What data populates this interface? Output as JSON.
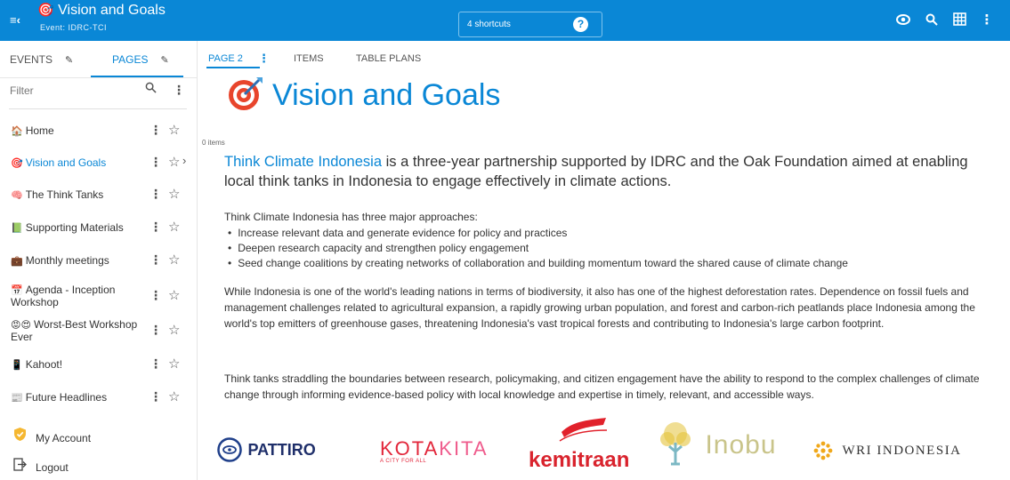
{
  "topbar": {
    "menu_icon": "menu-collapse-icon",
    "title_emoji": "🎯",
    "title": "Vision and Goals",
    "event": "Event: IDRC-TCI",
    "shortcuts_label": "4 shortcuts",
    "help_glyph": "?",
    "icons": [
      "eye-icon",
      "search-icon",
      "grid-icon",
      "more-vertical-icon"
    ],
    "accent": "#0a87d6"
  },
  "left": {
    "tabs": [
      {
        "label": "EVENTS",
        "active": false
      },
      {
        "label": "PAGES",
        "active": true
      }
    ],
    "filter_placeholder": "Filter",
    "pages": [
      {
        "icon": "🏠",
        "label": "Home"
      },
      {
        "icon": "🎯",
        "label": "Vision and Goals",
        "active": true
      },
      {
        "icon": "🧠",
        "label": "The Think Tanks"
      },
      {
        "icon": "📗",
        "label": "Supporting Materials"
      },
      {
        "icon": "💼",
        "label": "Monthly meetings"
      },
      {
        "icon": "📅",
        "label": "Agenda - Inception Workshop"
      },
      {
        "icon": "😡😍",
        "label": "Worst-Best Workshop Ever"
      },
      {
        "icon": "📱",
        "label": "Kahoot!"
      },
      {
        "icon": "📰",
        "label": "Future Headlines"
      }
    ],
    "account": {
      "icon": "shield-icon",
      "label": "My Account"
    },
    "logout": {
      "icon": "logout-icon",
      "label": "Logout"
    }
  },
  "main": {
    "subtabs": [
      {
        "label": "PAGE 2",
        "active": true
      },
      {
        "label": "ITEMS",
        "active": false
      },
      {
        "label": "TABLE PLANS",
        "active": false
      }
    ],
    "heading": "Vision and Goals",
    "items_count": "0 items",
    "intro_lead": "Think Climate Indonesia",
    "intro_rest": " is a three-year partnership supported by IDRC and the Oak Foundation aimed at enabling local think tanks in Indonesia to engage effectively in climate actions.",
    "approaches_title": "Think Climate Indonesia has three major approaches:",
    "approaches": [
      "Increase relevant data and generate evidence for policy and practices",
      "Deepen research capacity and strengthen policy engagement",
      "Seed change coalitions by creating networks of collaboration and building momentum toward the shared cause of climate change"
    ],
    "para1": "While Indonesia is one of the world's leading nations in terms of biodiversity, it also has one of the highest deforestation rates. Dependence on fossil fuels and management challenges related to agricultural expansion, a rapidly growing urban population, and forest and carbon-rich peatlands place Indonesia among the world's top emitters of greenhouse gases, threatening Indonesia's vast tropical forests and contributing to Indonesia's large carbon footprint.",
    "para2": "Think tanks straddling the boundaries between research, policymaking, and citizen engagement have the ability to respond to the complex challenges of climate change through informing evidence-based policy with local knowledge and expertise in timely, relevant, and accessible ways.",
    "logos": {
      "pattiro": "PATTIRO",
      "kotakita_a": "KOTA",
      "kotakita_b": "KITA",
      "kotakita_sub": "A CITY FOR ALL",
      "kemitraan": "kemitraan",
      "inobu": "Inobu",
      "wri": "WRI INDONESIA"
    }
  }
}
